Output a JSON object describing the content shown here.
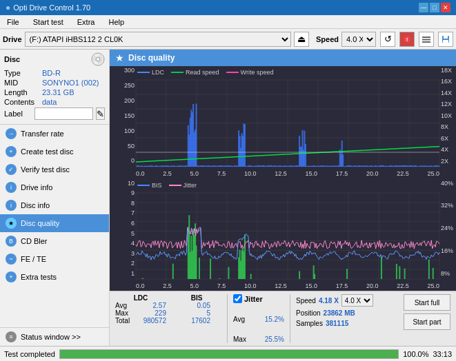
{
  "titleBar": {
    "title": "Opti Drive Control 1.70",
    "minimize": "—",
    "maximize": "□",
    "close": "✕"
  },
  "menuBar": {
    "items": [
      "File",
      "Start test",
      "Extra",
      "Help"
    ]
  },
  "driveBar": {
    "label": "Drive",
    "driveValue": "(F:) ATAPI iHBS112  2 CL0K",
    "speedLabel": "Speed",
    "speedValue": "4.0 X"
  },
  "disc": {
    "header": "Disc",
    "typeLabel": "Type",
    "typeValue": "BD-R",
    "midLabel": "MID",
    "midValue": "SONYNO1 (002)",
    "lengthLabel": "Length",
    "lengthValue": "23.31 GB",
    "contentsLabel": "Contents",
    "contentsValue": "data",
    "labelLabel": "Label"
  },
  "nav": {
    "items": [
      {
        "id": "transfer-rate",
        "label": "Transfer rate",
        "active": false
      },
      {
        "id": "create-test-disc",
        "label": "Create test disc",
        "active": false
      },
      {
        "id": "verify-test-disc",
        "label": "Verify test disc",
        "active": false
      },
      {
        "id": "drive-info",
        "label": "Drive info",
        "active": false
      },
      {
        "id": "disc-info",
        "label": "Disc info",
        "active": false
      },
      {
        "id": "disc-quality",
        "label": "Disc quality",
        "active": true
      },
      {
        "id": "cd-bler",
        "label": "CD Bler",
        "active": false
      },
      {
        "id": "fe-te",
        "label": "FE / TE",
        "active": false
      },
      {
        "id": "extra-tests",
        "label": "Extra tests",
        "active": false
      }
    ],
    "statusWindow": "Status window >>"
  },
  "discQuality": {
    "title": "Disc quality",
    "legend": {
      "ldc": "LDC",
      "readSpeed": "Read speed",
      "writeSpeed": "Write speed",
      "bis": "BIS",
      "jitter": "Jitter"
    },
    "xLabels": [
      "0.0",
      "2.5",
      "5.0",
      "7.5",
      "10.0",
      "12.5",
      "15.0",
      "17.5",
      "20.0",
      "22.5",
      "25.0"
    ],
    "yTopLeft": [
      "300",
      "250",
      "200",
      "150",
      "100",
      "50",
      "0"
    ],
    "yTopRight": [
      "18X",
      "16X",
      "14X",
      "12X",
      "10X",
      "8X",
      "6X",
      "4X",
      "2X"
    ],
    "yBottomLeft": [
      "10",
      "9",
      "8",
      "7",
      "6",
      "5",
      "4",
      "3",
      "2",
      "1"
    ],
    "yBottomRight": [
      "40%",
      "32%",
      "24%",
      "16%",
      "8%"
    ]
  },
  "stats": {
    "ldcLabel": "LDC",
    "bisLabel": "BIS",
    "jitterLabel": "Jitter",
    "speedLabel": "Speed",
    "speedValue": "4.18 X",
    "speedSelectValue": "4.0 X",
    "positionLabel": "Position",
    "positionValue": "23862 MB",
    "samplesLabel": "Samples",
    "samplesValue": "381115",
    "rows": [
      {
        "label": "Avg",
        "ldc": "2.57",
        "bis": "0.05",
        "jitter": "15.2%"
      },
      {
        "label": "Max",
        "ldc": "229",
        "bis": "5",
        "jitter": "25.5%"
      },
      {
        "label": "Total",
        "ldc": "980572",
        "bis": "17602",
        "jitter": ""
      }
    ],
    "startFull": "Start full",
    "startPart": "Start part"
  },
  "bottomBar": {
    "status": "Test completed",
    "progress": 100,
    "progressText": "100.0%",
    "time": "33:13"
  }
}
